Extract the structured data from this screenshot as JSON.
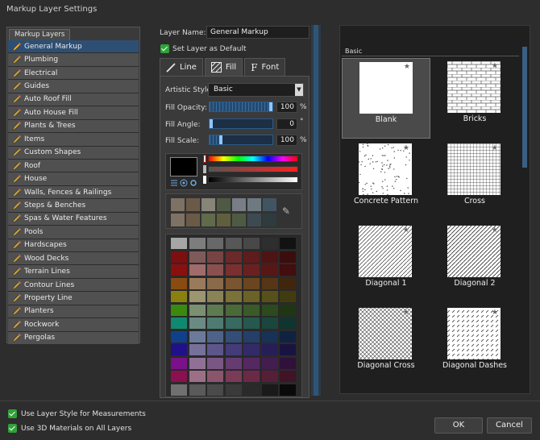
{
  "window": {
    "title": "Markup Layer Settings"
  },
  "layers": {
    "tab_label": "Markup Layers",
    "items": [
      {
        "label": "General Markup"
      },
      {
        "label": "Plumbing"
      },
      {
        "label": "Electrical"
      },
      {
        "label": "Guides"
      },
      {
        "label": "Auto Roof Fill"
      },
      {
        "label": "Auto House Fill"
      },
      {
        "label": "Plants & Trees"
      },
      {
        "label": "Items"
      },
      {
        "label": "Custom Shapes"
      },
      {
        "label": "Roof"
      },
      {
        "label": "House"
      },
      {
        "label": "Walls, Fences & Railings"
      },
      {
        "label": "Steps & Benches"
      },
      {
        "label": "Spas & Water Features"
      },
      {
        "label": "Pools"
      },
      {
        "label": "Hardscapes"
      },
      {
        "label": "Wood Decks"
      },
      {
        "label": "Terrain Lines"
      },
      {
        "label": "Contour Lines"
      },
      {
        "label": "Property Line"
      },
      {
        "label": "Planters"
      },
      {
        "label": "Rockwork"
      },
      {
        "label": "Pergolas"
      }
    ],
    "selected": "General Markup"
  },
  "layer_name": {
    "label": "Layer Name:",
    "value": "General Markup"
  },
  "set_default": {
    "label": "Set Layer as Default",
    "checked": true
  },
  "tabs": [
    {
      "label": "Line",
      "icon": "pencil-line-icon"
    },
    {
      "label": "Fill",
      "icon": "hatch-fill-icon",
      "active": true
    },
    {
      "label": "Font",
      "icon": "font-f-icon"
    }
  ],
  "fill": {
    "artistic_style_label": "Artistic Style:",
    "artistic_style_value": "Basic",
    "opacity_label": "Fill Opacity:",
    "opacity_value": "100",
    "opacity_unit": "%",
    "opacity_level": 1.0,
    "angle_label": "Fill Angle:",
    "angle_value": "0",
    "angle_unit": "°",
    "angle_level": 0.0,
    "scale_label": "Fill Scale:",
    "scale_value": "100",
    "scale_unit": "%",
    "scale_level": 0.16,
    "current_color": "#000000"
  },
  "colors": {
    "recent": [
      [
        "#7d7264",
        "#6b5a47",
        "#878478",
        "#4f5a44",
        "#797d86",
        "#6e7a82",
        "#415461",
        "#7a3d2a"
      ],
      [
        "#7d7264",
        "#6b5a47",
        "#5f6b4a",
        "#5f5f3e",
        "#4f5a44",
        "#3e4a52",
        "#2e3b3f",
        "#5a3222"
      ]
    ],
    "palette": [
      [
        "#a6a6a6",
        "#7d7d7d",
        "#686868",
        "#575757",
        "#484848",
        "#2e2e2e",
        "#121212"
      ],
      [
        "#7c0f0f",
        "#7f5a5a",
        "#764444",
        "#6a2a2a",
        "#5e1c1c",
        "#4e1414",
        "#3b0d0d"
      ],
      [
        "#8a1010",
        "#a06b6b",
        "#8a5050",
        "#7a3030",
        "#6a2020",
        "#581616",
        "#420e0e"
      ],
      [
        "#8a4b10",
        "#9b7a5b",
        "#8a6a48",
        "#7a5530",
        "#6a4520",
        "#573616",
        "#41260e"
      ],
      [
        "#8a8010",
        "#9b9570",
        "#8a8358",
        "#7a7238",
        "#6a6226",
        "#57501a",
        "#413c10"
      ],
      [
        "#3b8a10",
        "#7a9070",
        "#5e7a50",
        "#4a6a38",
        "#3a5a28",
        "#2c4a1e",
        "#1e3614"
      ],
      [
        "#0f8a70",
        "#6a8a84",
        "#4f7a72",
        "#376a60",
        "#27584e",
        "#1a463e",
        "#10342e"
      ],
      [
        "#10408a",
        "#6a7a9b",
        "#4f638a",
        "#344e7a",
        "#253f6a",
        "#183157",
        "#0f2341"
      ],
      [
        "#20108a",
        "#76709b",
        "#5c568a",
        "#433b7a",
        "#332a6a",
        "#261e57",
        "#191341"
      ],
      [
        "#7a108a",
        "#907095",
        "#7a5684",
        "#663b72",
        "#552862",
        "#431c50",
        "#30113a"
      ],
      [
        "#8a1050",
        "#9b7086",
        "#8a566e",
        "#7a3b58",
        "#6a2a47",
        "#571e38",
        "#411327"
      ],
      [
        "#707070",
        "#5a5a5a",
        "#4a4a4a",
        "#3a3a3a",
        "#2a2a2a",
        "#1a1a1a",
        "#0a0a0a"
      ]
    ]
  },
  "gallery": {
    "section_label": "Basic",
    "items": [
      {
        "name": "Blank",
        "selected": true,
        "pattern": "blank"
      },
      {
        "name": "Bricks",
        "pattern": "bricks"
      },
      {
        "name": "Concrete Pattern",
        "pattern": "concrete"
      },
      {
        "name": "Cross",
        "pattern": "cross"
      },
      {
        "name": "Diagonal 1",
        "pattern": "diag1"
      },
      {
        "name": "Diagonal 2",
        "pattern": "diag2"
      },
      {
        "name": "Diagonal Cross",
        "pattern": "diagcross"
      },
      {
        "name": "Diagonal Dashes",
        "pattern": "diagdash"
      }
    ],
    "star": "★"
  },
  "footer": {
    "use_layer_style": "Use Layer Style for Measurements",
    "use_3d": "Use 3D Materials on All Layers",
    "ok": "OK",
    "cancel": "Cancel"
  }
}
